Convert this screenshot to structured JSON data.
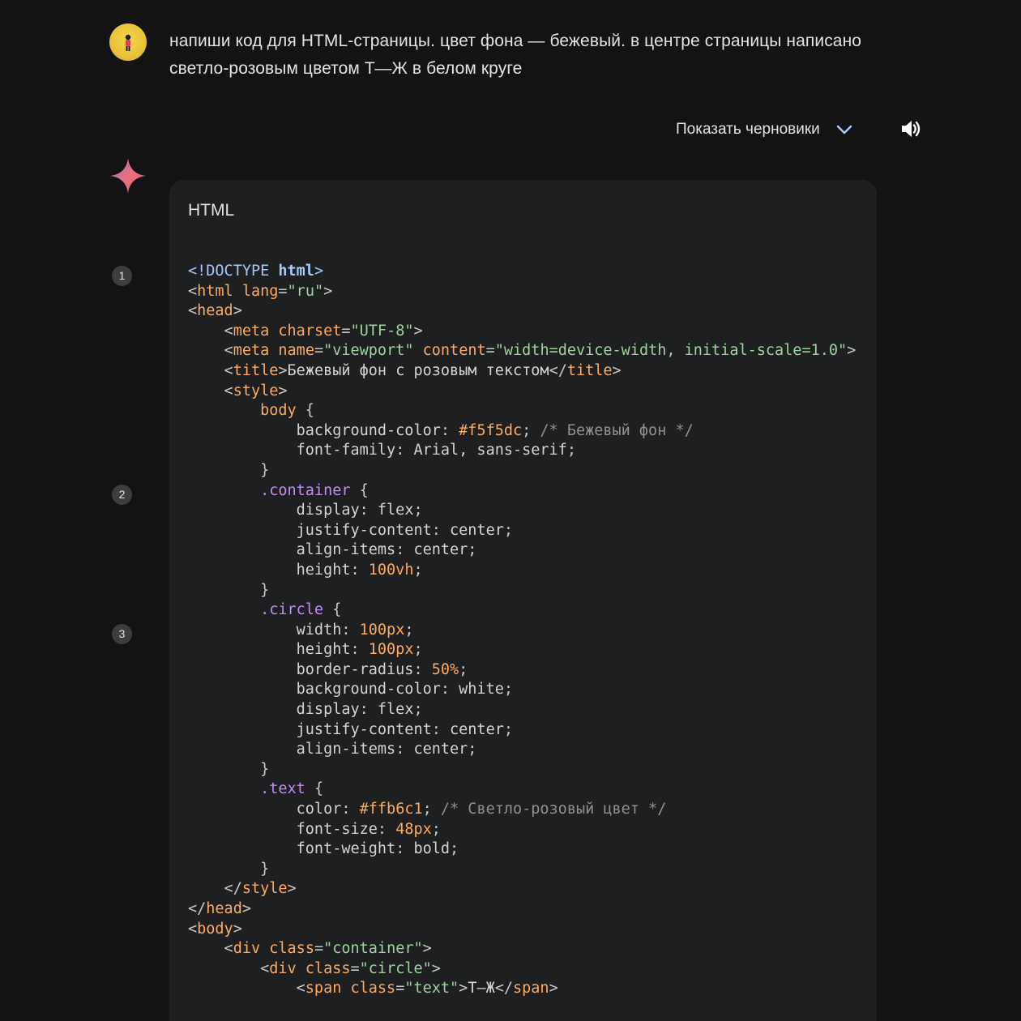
{
  "prompt": {
    "text": "напиши код для HTML-страницы. цвет фона — бежевый. в центре страницы написано светло-розовым цветом Т—Ж в белом круге"
  },
  "response": {
    "drafts_label": "Показать черновики",
    "code_language": "HTML",
    "citations": [
      "1",
      "2",
      "3"
    ],
    "code_lines": [
      [
        [
          "t-doctype",
          "<!DOCTYPE "
        ],
        [
          "t-tagbold",
          "html"
        ],
        [
          "t-doctype",
          ">"
        ]
      ],
      [
        [
          "t-punct",
          "<"
        ],
        [
          "t-tagname",
          "html"
        ],
        [
          "t-punct",
          " "
        ],
        [
          "t-attr",
          "lang"
        ],
        [
          "t-punct",
          "="
        ],
        [
          "t-str",
          "\"ru\""
        ],
        [
          "t-punct",
          ">"
        ]
      ],
      [
        [
          "t-punct",
          "<"
        ],
        [
          "t-tagname",
          "head"
        ],
        [
          "t-punct",
          ">"
        ]
      ],
      [
        [
          "t-punct",
          "    <"
        ],
        [
          "t-tagname",
          "meta"
        ],
        [
          "t-punct",
          " "
        ],
        [
          "t-attr",
          "charset"
        ],
        [
          "t-punct",
          "="
        ],
        [
          "t-str",
          "\"UTF-8\""
        ],
        [
          "t-punct",
          ">"
        ]
      ],
      [
        [
          "t-punct",
          "    <"
        ],
        [
          "t-tagname",
          "meta"
        ],
        [
          "t-punct",
          " "
        ],
        [
          "t-attr",
          "name"
        ],
        [
          "t-punct",
          "="
        ],
        [
          "t-str",
          "\"viewport\""
        ],
        [
          "t-punct",
          " "
        ],
        [
          "t-attr",
          "content"
        ],
        [
          "t-punct",
          "="
        ],
        [
          "t-str",
          "\"width=device-width, initial-scale=1.0\""
        ],
        [
          "t-punct",
          ">"
        ]
      ],
      [
        [
          "t-punct",
          "    <"
        ],
        [
          "t-tagname",
          "title"
        ],
        [
          "t-punct",
          ">"
        ],
        [
          "t-text",
          "Бежевый фон с розовым текстом"
        ],
        [
          "t-punct",
          "</"
        ],
        [
          "t-tagname",
          "title"
        ],
        [
          "t-punct",
          ">"
        ]
      ],
      [
        [
          "t-punct",
          "    <"
        ],
        [
          "t-tagname",
          "style"
        ],
        [
          "t-punct",
          ">"
        ]
      ],
      [
        [
          "t-punct",
          "        "
        ],
        [
          "t-tagname",
          "body"
        ],
        [
          "t-punct",
          " {"
        ]
      ],
      [
        [
          "t-punct",
          "            "
        ],
        [
          "t-prop",
          "background-color"
        ],
        [
          "t-punct",
          ": "
        ],
        [
          "t-num",
          "#f5f5dc"
        ],
        [
          "t-punct",
          "; "
        ],
        [
          "t-comment",
          "/* Бежевый фон */"
        ]
      ],
      [
        [
          "t-punct",
          "            "
        ],
        [
          "t-prop",
          "font-family"
        ],
        [
          "t-punct",
          ": "
        ],
        [
          "t-kw",
          "Arial, sans-serif"
        ],
        [
          "t-punct",
          ";"
        ]
      ],
      [
        [
          "t-punct",
          "        }"
        ]
      ],
      [
        [
          "t-punct",
          "        "
        ],
        [
          "t-sel",
          ".container"
        ],
        [
          "t-punct",
          " {"
        ]
      ],
      [
        [
          "t-punct",
          "            "
        ],
        [
          "t-prop",
          "display"
        ],
        [
          "t-punct",
          ": "
        ],
        [
          "t-kw",
          "flex"
        ],
        [
          "t-punct",
          ";"
        ]
      ],
      [
        [
          "t-punct",
          "            "
        ],
        [
          "t-prop",
          "justify-content"
        ],
        [
          "t-punct",
          ": "
        ],
        [
          "t-kw",
          "center"
        ],
        [
          "t-punct",
          ";"
        ]
      ],
      [
        [
          "t-punct",
          "            "
        ],
        [
          "t-prop",
          "align-items"
        ],
        [
          "t-punct",
          ": "
        ],
        [
          "t-kw",
          "center"
        ],
        [
          "t-punct",
          ";"
        ]
      ],
      [
        [
          "t-punct",
          "            "
        ],
        [
          "t-prop",
          "height"
        ],
        [
          "t-punct",
          ": "
        ],
        [
          "t-num",
          "100vh"
        ],
        [
          "t-punct",
          ";"
        ]
      ],
      [
        [
          "t-punct",
          "        }"
        ]
      ],
      [
        [
          "t-punct",
          "        "
        ],
        [
          "t-sel",
          ".circle"
        ],
        [
          "t-punct",
          " {"
        ]
      ],
      [
        [
          "t-punct",
          "            "
        ],
        [
          "t-prop",
          "width"
        ],
        [
          "t-punct",
          ": "
        ],
        [
          "t-num",
          "100px"
        ],
        [
          "t-punct",
          ";"
        ]
      ],
      [
        [
          "t-punct",
          "            "
        ],
        [
          "t-prop",
          "height"
        ],
        [
          "t-punct",
          ": "
        ],
        [
          "t-num",
          "100px"
        ],
        [
          "t-punct",
          ";"
        ]
      ],
      [
        [
          "t-punct",
          "            "
        ],
        [
          "t-prop",
          "border-radius"
        ],
        [
          "t-punct",
          ": "
        ],
        [
          "t-num",
          "50%"
        ],
        [
          "t-punct",
          ";"
        ]
      ],
      [
        [
          "t-punct",
          "            "
        ],
        [
          "t-prop",
          "background-color"
        ],
        [
          "t-punct",
          ": "
        ],
        [
          "t-kw",
          "white"
        ],
        [
          "t-punct",
          ";"
        ]
      ],
      [
        [
          "t-punct",
          "            "
        ],
        [
          "t-prop",
          "display"
        ],
        [
          "t-punct",
          ": "
        ],
        [
          "t-kw",
          "flex"
        ],
        [
          "t-punct",
          ";"
        ]
      ],
      [
        [
          "t-punct",
          "            "
        ],
        [
          "t-prop",
          "justify-content"
        ],
        [
          "t-punct",
          ": "
        ],
        [
          "t-kw",
          "center"
        ],
        [
          "t-punct",
          ";"
        ]
      ],
      [
        [
          "t-punct",
          "            "
        ],
        [
          "t-prop",
          "align-items"
        ],
        [
          "t-punct",
          ": "
        ],
        [
          "t-kw",
          "center"
        ],
        [
          "t-punct",
          ";"
        ]
      ],
      [
        [
          "t-punct",
          "        }"
        ]
      ],
      [
        [
          "t-punct",
          "        "
        ],
        [
          "t-sel",
          ".text"
        ],
        [
          "t-punct",
          " {"
        ]
      ],
      [
        [
          "t-punct",
          "            "
        ],
        [
          "t-prop",
          "color"
        ],
        [
          "t-punct",
          ": "
        ],
        [
          "t-num",
          "#ffb6c1"
        ],
        [
          "t-punct",
          "; "
        ],
        [
          "t-comment",
          "/* Светло-розовый цвет */"
        ]
      ],
      [
        [
          "t-punct",
          "            "
        ],
        [
          "t-prop",
          "font-size"
        ],
        [
          "t-punct",
          ": "
        ],
        [
          "t-num",
          "48px"
        ],
        [
          "t-punct",
          ";"
        ]
      ],
      [
        [
          "t-punct",
          "            "
        ],
        [
          "t-prop",
          "font-weight"
        ],
        [
          "t-punct",
          ": "
        ],
        [
          "t-kw",
          "bold"
        ],
        [
          "t-punct",
          ";"
        ]
      ],
      [
        [
          "t-punct",
          "        }"
        ]
      ],
      [
        [
          "t-punct",
          "    </"
        ],
        [
          "t-tagname",
          "style"
        ],
        [
          "t-punct",
          ">"
        ]
      ],
      [
        [
          "t-punct",
          "</"
        ],
        [
          "t-tagname",
          "head"
        ],
        [
          "t-punct",
          ">"
        ]
      ],
      [
        [
          "t-punct",
          "<"
        ],
        [
          "t-tagname",
          "body"
        ],
        [
          "t-punct",
          ">"
        ]
      ],
      [
        [
          "t-punct",
          "    <"
        ],
        [
          "t-tagname",
          "div"
        ],
        [
          "t-punct",
          " "
        ],
        [
          "t-attr",
          "class"
        ],
        [
          "t-punct",
          "="
        ],
        [
          "t-str",
          "\"container\""
        ],
        [
          "t-punct",
          ">"
        ]
      ],
      [
        [
          "t-punct",
          "        <"
        ],
        [
          "t-tagname",
          "div"
        ],
        [
          "t-punct",
          " "
        ],
        [
          "t-attr",
          "class"
        ],
        [
          "t-punct",
          "="
        ],
        [
          "t-str",
          "\"circle\""
        ],
        [
          "t-punct",
          ">"
        ]
      ],
      [
        [
          "t-punct",
          "            <"
        ],
        [
          "t-tagname",
          "span"
        ],
        [
          "t-punct",
          " "
        ],
        [
          "t-attr",
          "class"
        ],
        [
          "t-punct",
          "="
        ],
        [
          "t-str",
          "\"text\""
        ],
        [
          "t-punct",
          ">"
        ],
        [
          "t-text",
          "Т—Ж"
        ],
        [
          "t-punct",
          "</"
        ],
        [
          "t-tagname",
          "span"
        ],
        [
          "t-punct",
          ">"
        ]
      ]
    ]
  },
  "icons": {
    "avatar": "user-avatar",
    "drafts_chevron": "chevron-down-icon",
    "speaker": "speaker-icon",
    "assistant": "gemini-sparkle-icon"
  },
  "colors": {
    "background": "#131314",
    "card": "#1e1f20",
    "text": "#e3e3e3",
    "chevron": "#a8c7fa"
  }
}
